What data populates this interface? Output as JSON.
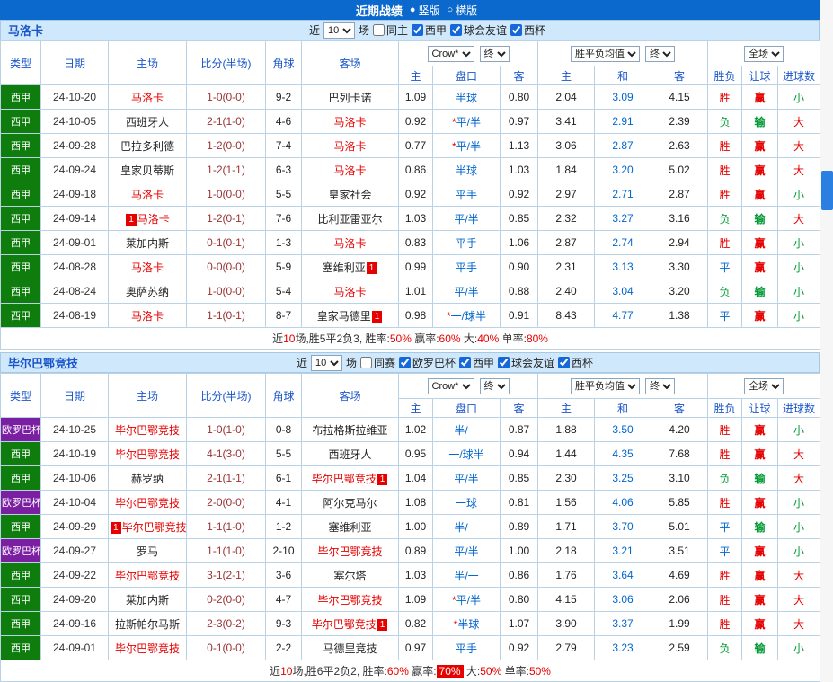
{
  "topbar": {
    "title": "近期战绩",
    "radios": [
      {
        "label": "竖版",
        "selected": true
      },
      {
        "label": "横版",
        "selected": false
      }
    ]
  },
  "filter": {
    "near_label": "近",
    "count_value": "10",
    "games_label": "场"
  },
  "table_header": {
    "static": [
      "类型",
      "日期",
      "主场",
      "比分(半场)",
      "角球",
      "客场"
    ],
    "group1_selects": [
      "Crow*",
      "终"
    ],
    "group2_selects": [
      "胜平负均值",
      "终"
    ],
    "group3_selects": [
      "全场"
    ],
    "sub": [
      "主",
      "盘口",
      "客",
      "主",
      "和",
      "客",
      "胜负",
      "让球",
      "进球数"
    ]
  },
  "badge_text": "1",
  "colors": {
    "topbar_bg": "#0b68cc",
    "header_text": "#1a56c8",
    "green_league": "#0e7d0e",
    "purple_league": "#7b1fa2",
    "win_red": "#e60000",
    "lose_green": "#009933",
    "draw_blue": "#0066cc",
    "handicap_blue": "#0066cc",
    "score_color": "#993333",
    "filterbar_bg": "#cfe8fb",
    "border": "#b9d2e6",
    "scrollbar_thumb": "#2a7fe0"
  },
  "sections": [
    {
      "team": "马洛卡",
      "checkboxes": [
        {
          "label": "同主",
          "checked": false
        },
        {
          "label": "西甲",
          "checked": true
        },
        {
          "label": "球会友谊",
          "checked": true
        },
        {
          "label": "西杯",
          "checked": true
        }
      ],
      "rows": [
        {
          "type": "西甲",
          "tc": "green",
          "date": "24-10-20",
          "home": "马洛卡",
          "hf": true,
          "hb": null,
          "score": "1-0(0-0)",
          "corners": "9-2",
          "away": "巴列卡诺",
          "af": false,
          "ab": null,
          "ah": [
            "1.09",
            "半球",
            "0.80"
          ],
          "eu": [
            "2.04",
            "3.09",
            "4.15"
          ],
          "res": "胜",
          "bet": "赢",
          "ou": "小"
        },
        {
          "type": "西甲",
          "tc": "green",
          "date": "24-10-05",
          "home": "西班牙人",
          "hf": false,
          "hb": null,
          "score": "2-1(1-0)",
          "corners": "4-6",
          "away": "马洛卡",
          "af": true,
          "ab": null,
          "ah": [
            "0.92",
            "*平/半",
            "0.97"
          ],
          "eu": [
            "3.41",
            "2.91",
            "2.39"
          ],
          "res": "负",
          "bet": "输",
          "ou": "大"
        },
        {
          "type": "西甲",
          "tc": "green",
          "date": "24-09-28",
          "home": "巴拉多利德",
          "hf": false,
          "hb": null,
          "score": "1-2(0-0)",
          "corners": "7-4",
          "away": "马洛卡",
          "af": true,
          "ab": null,
          "ah": [
            "0.77",
            "*平/半",
            "1.13"
          ],
          "eu": [
            "3.06",
            "2.87",
            "2.63"
          ],
          "res": "胜",
          "bet": "赢",
          "ou": "大"
        },
        {
          "type": "西甲",
          "tc": "green",
          "date": "24-09-24",
          "home": "皇家贝蒂斯",
          "hf": false,
          "hb": null,
          "score": "1-2(1-1)",
          "corners": "6-3",
          "away": "马洛卡",
          "af": true,
          "ab": null,
          "ah": [
            "0.86",
            "半球",
            "1.03"
          ],
          "eu": [
            "1.84",
            "3.20",
            "5.02"
          ],
          "res": "胜",
          "bet": "赢",
          "ou": "大"
        },
        {
          "type": "西甲",
          "tc": "green",
          "date": "24-09-18",
          "home": "马洛卡",
          "hf": true,
          "hb": null,
          "score": "1-0(0-0)",
          "corners": "5-5",
          "away": "皇家社会",
          "af": false,
          "ab": null,
          "ah": [
            "0.92",
            "平手",
            "0.92"
          ],
          "eu": [
            "2.97",
            "2.71",
            "2.87"
          ],
          "res": "胜",
          "bet": "赢",
          "ou": "小"
        },
        {
          "type": "西甲",
          "tc": "green",
          "date": "24-09-14",
          "home": "马洛卡",
          "hf": true,
          "hb": "pre",
          "score": "1-2(0-1)",
          "corners": "7-6",
          "away": "比利亚雷亚尔",
          "af": false,
          "ab": null,
          "ah": [
            "1.03",
            "平/半",
            "0.85"
          ],
          "eu": [
            "2.32",
            "3.27",
            "3.16"
          ],
          "res": "负",
          "bet": "输",
          "ou": "大"
        },
        {
          "type": "西甲",
          "tc": "green",
          "date": "24-09-01",
          "home": "莱加内斯",
          "hf": false,
          "hb": null,
          "score": "0-1(0-1)",
          "corners": "1-3",
          "away": "马洛卡",
          "af": true,
          "ab": null,
          "ah": [
            "0.83",
            "平手",
            "1.06"
          ],
          "eu": [
            "2.87",
            "2.74",
            "2.94"
          ],
          "res": "胜",
          "bet": "赢",
          "ou": "小"
        },
        {
          "type": "西甲",
          "tc": "green",
          "date": "24-08-28",
          "home": "马洛卡",
          "hf": true,
          "hb": null,
          "score": "0-0(0-0)",
          "corners": "5-9",
          "away": "塞维利亚",
          "af": false,
          "ab": "post",
          "ah": [
            "0.99",
            "平手",
            "0.90"
          ],
          "eu": [
            "2.31",
            "3.13",
            "3.30"
          ],
          "res": "平",
          "bet": "赢",
          "ou": "小"
        },
        {
          "type": "西甲",
          "tc": "green",
          "date": "24-08-24",
          "home": "奥萨苏纳",
          "hf": false,
          "hb": null,
          "score": "1-0(0-0)",
          "corners": "5-4",
          "away": "马洛卡",
          "af": true,
          "ab": null,
          "ah": [
            "1.01",
            "平/半",
            "0.88"
          ],
          "eu": [
            "2.40",
            "3.04",
            "3.20"
          ],
          "res": "负",
          "bet": "输",
          "ou": "小"
        },
        {
          "type": "西甲",
          "tc": "green",
          "date": "24-08-19",
          "home": "马洛卡",
          "hf": true,
          "hb": null,
          "score": "1-1(0-1)",
          "corners": "8-7",
          "away": "皇家马德里",
          "af": false,
          "ab": "post",
          "ah": [
            "0.98",
            "*一/球半",
            "0.91"
          ],
          "eu": [
            "8.43",
            "4.77",
            "1.38"
          ],
          "res": "平",
          "bet": "赢",
          "ou": "小"
        }
      ],
      "summary": [
        {
          "t": "近"
        },
        {
          "t": "10",
          "c": "red"
        },
        {
          "t": "场,胜5平2负3,  "
        },
        {
          "t": "胜率:"
        },
        {
          "t": "50%",
          "c": "red"
        },
        {
          "t": "  赢率:"
        },
        {
          "t": "60%",
          "c": "red"
        },
        {
          "t": "  大:"
        },
        {
          "t": "40%",
          "c": "red"
        },
        {
          "t": "  单率:"
        },
        {
          "t": "80%",
          "c": "red"
        }
      ]
    },
    {
      "team": "毕尔巴鄂竞技",
      "checkboxes": [
        {
          "label": "同赛",
          "checked": false
        },
        {
          "label": "欧罗巴杯",
          "checked": true
        },
        {
          "label": "西甲",
          "checked": true
        },
        {
          "label": "球会友谊",
          "checked": true
        },
        {
          "label": "西杯",
          "checked": true
        }
      ],
      "rows": [
        {
          "type": "欧罗巴杯",
          "tc": "purple",
          "date": "24-10-25",
          "home": "毕尔巴鄂竞技",
          "hf": true,
          "hb": null,
          "score": "1-0(1-0)",
          "corners": "0-8",
          "away": "布拉格斯拉维亚",
          "af": false,
          "ab": null,
          "ah": [
            "1.02",
            "半/一",
            "0.87"
          ],
          "eu": [
            "1.88",
            "3.50",
            "4.20"
          ],
          "res": "胜",
          "bet": "赢",
          "ou": "小"
        },
        {
          "type": "西甲",
          "tc": "green",
          "date": "24-10-19",
          "home": "毕尔巴鄂竞技",
          "hf": true,
          "hb": null,
          "score": "4-1(3-0)",
          "corners": "5-5",
          "away": "西班牙人",
          "af": false,
          "ab": null,
          "ah": [
            "0.95",
            "一/球半",
            "0.94"
          ],
          "eu": [
            "1.44",
            "4.35",
            "7.68"
          ],
          "res": "胜",
          "bet": "赢",
          "ou": "大"
        },
        {
          "type": "西甲",
          "tc": "green",
          "date": "24-10-06",
          "home": "赫罗纳",
          "hf": false,
          "hb": null,
          "score": "2-1(1-1)",
          "corners": "6-1",
          "away": "毕尔巴鄂竞技",
          "af": true,
          "ab": "post",
          "ah": [
            "1.04",
            "平/半",
            "0.85"
          ],
          "eu": [
            "2.30",
            "3.25",
            "3.10"
          ],
          "res": "负",
          "bet": "输",
          "ou": "大"
        },
        {
          "type": "欧罗巴杯",
          "tc": "purple",
          "date": "24-10-04",
          "home": "毕尔巴鄂竞技",
          "hf": true,
          "hb": null,
          "score": "2-0(0-0)",
          "corners": "4-1",
          "away": "阿尔克马尔",
          "af": false,
          "ab": null,
          "ah": [
            "1.08",
            "一球",
            "0.81"
          ],
          "eu": [
            "1.56",
            "4.06",
            "5.85"
          ],
          "res": "胜",
          "bet": "赢",
          "ou": "小"
        },
        {
          "type": "西甲",
          "tc": "green",
          "date": "24-09-29",
          "home": "毕尔巴鄂竞技",
          "hf": true,
          "hb": "pre",
          "score": "1-1(1-0)",
          "corners": "1-2",
          "away": "塞维利亚",
          "af": false,
          "ab": null,
          "ah": [
            "1.00",
            "半/一",
            "0.89"
          ],
          "eu": [
            "1.71",
            "3.70",
            "5.01"
          ],
          "res": "平",
          "bet": "输",
          "ou": "小"
        },
        {
          "type": "欧罗巴杯",
          "tc": "purple",
          "date": "24-09-27",
          "home": "罗马",
          "hf": false,
          "hb": null,
          "score": "1-1(1-0)",
          "corners": "2-10",
          "away": "毕尔巴鄂竞技",
          "af": true,
          "ab": null,
          "ah": [
            "0.89",
            "平/半",
            "1.00"
          ],
          "eu": [
            "2.18",
            "3.21",
            "3.51"
          ],
          "res": "平",
          "bet": "赢",
          "ou": "小"
        },
        {
          "type": "西甲",
          "tc": "green",
          "date": "24-09-22",
          "home": "毕尔巴鄂竞技",
          "hf": true,
          "hb": null,
          "score": "3-1(2-1)",
          "corners": "3-6",
          "away": "塞尔塔",
          "af": false,
          "ab": null,
          "ah": [
            "1.03",
            "半/一",
            "0.86"
          ],
          "eu": [
            "1.76",
            "3.64",
            "4.69"
          ],
          "res": "胜",
          "bet": "赢",
          "ou": "大"
        },
        {
          "type": "西甲",
          "tc": "green",
          "date": "24-09-20",
          "home": "莱加内斯",
          "hf": false,
          "hb": null,
          "score": "0-2(0-0)",
          "corners": "4-7",
          "away": "毕尔巴鄂竞技",
          "af": true,
          "ab": null,
          "ah": [
            "1.09",
            "*平/半",
            "0.80"
          ],
          "eu": [
            "4.15",
            "3.06",
            "2.06"
          ],
          "res": "胜",
          "bet": "赢",
          "ou": "大"
        },
        {
          "type": "西甲",
          "tc": "green",
          "date": "24-09-16",
          "home": "拉斯帕尔马斯",
          "hf": false,
          "hb": null,
          "score": "2-3(0-2)",
          "corners": "9-3",
          "away": "毕尔巴鄂竞技",
          "af": true,
          "ab": "post",
          "ah": [
            "0.82",
            "*半球",
            "1.07"
          ],
          "eu": [
            "3.90",
            "3.37",
            "1.99"
          ],
          "res": "胜",
          "bet": "赢",
          "ou": "大"
        },
        {
          "type": "西甲",
          "tc": "green",
          "date": "24-09-01",
          "home": "毕尔巴鄂竞技",
          "hf": true,
          "hb": null,
          "score": "0-1(0-0)",
          "corners": "2-2",
          "away": "马德里竞技",
          "af": false,
          "ab": null,
          "ah": [
            "0.97",
            "平手",
            "0.92"
          ],
          "eu": [
            "2.79",
            "3.23",
            "2.59"
          ],
          "res": "负",
          "bet": "输",
          "ou": "小"
        }
      ],
      "summary": [
        {
          "t": "近"
        },
        {
          "t": "10",
          "c": "red"
        },
        {
          "t": "场,胜6平2负2,  "
        },
        {
          "t": "胜率:"
        },
        {
          "t": "60%",
          "c": "red"
        },
        {
          "t": "  赢率:"
        },
        {
          "t": "70%",
          "c": "redbox"
        },
        {
          "t": "  大:"
        },
        {
          "t": "50%",
          "c": "red"
        },
        {
          "t": "  单率:"
        },
        {
          "t": "50%",
          "c": "red"
        }
      ]
    }
  ]
}
